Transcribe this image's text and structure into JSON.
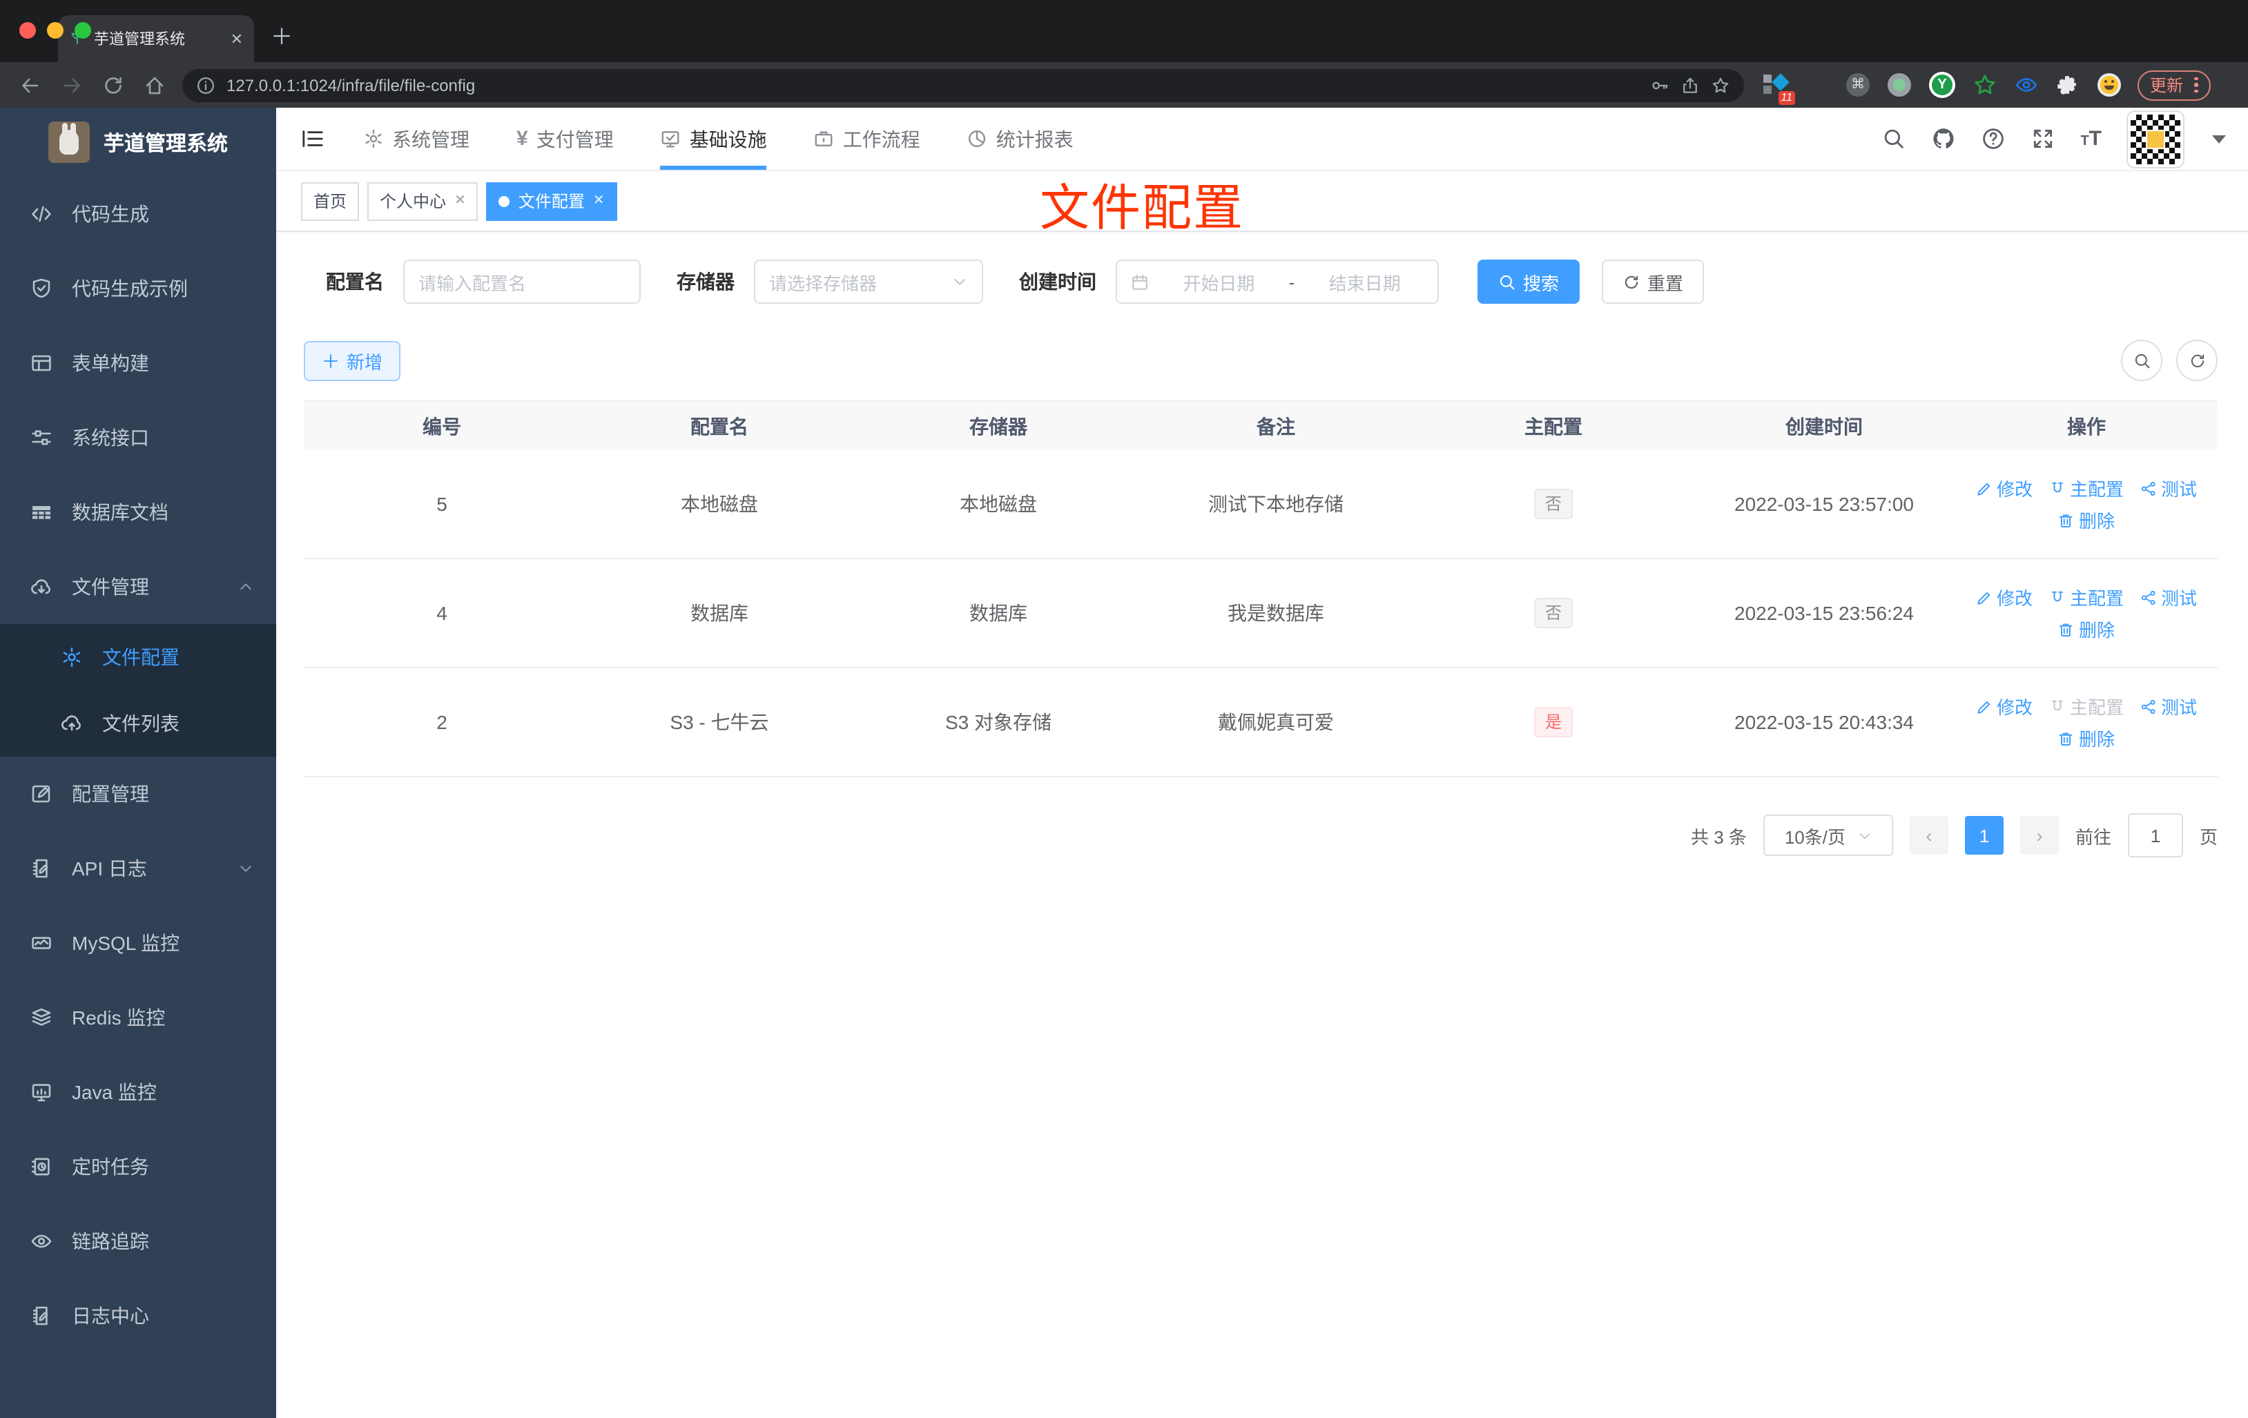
{
  "browser": {
    "tab_title": "芋道管理系统",
    "url": "127.0.0.1:1024/infra/file/file-config",
    "extensions_badge": "11",
    "update_label": "更新"
  },
  "sidebar": {
    "title": "芋道管理系统",
    "items": [
      {
        "label": "代码生成",
        "icon": "code-icon"
      },
      {
        "label": "代码生成示例",
        "icon": "shield-check-icon"
      },
      {
        "label": "表单构建",
        "icon": "form-icon"
      },
      {
        "label": "系统接口",
        "icon": "sliders-icon"
      },
      {
        "label": "数据库文档",
        "icon": "table-grid-icon"
      },
      {
        "label": "文件管理",
        "icon": "cloud-download-icon",
        "expanded": true,
        "children": [
          {
            "label": "文件配置",
            "icon": "gear-icon",
            "active": true
          },
          {
            "label": "文件列表",
            "icon": "cloud-upload-icon"
          }
        ]
      },
      {
        "label": "配置管理",
        "icon": "edit-square-icon"
      },
      {
        "label": "API 日志",
        "icon": "log-pen-icon",
        "collapsed": true
      },
      {
        "label": "MySQL 监控",
        "icon": "chart-card-icon"
      },
      {
        "label": "Redis 监控",
        "icon": "layers-icon"
      },
      {
        "label": "Java 监控",
        "icon": "monitor-icon"
      },
      {
        "label": "定时任务",
        "icon": "schedule-icon"
      },
      {
        "label": "链路追踪",
        "icon": "eye-icon"
      },
      {
        "label": "日志中心",
        "icon": "log-pen-icon"
      }
    ]
  },
  "topnav": {
    "items": [
      {
        "label": "系统管理",
        "icon": "gear-icon"
      },
      {
        "label": "支付管理",
        "icon": "yen-icon"
      },
      {
        "label": "基础设施",
        "icon": "infra-icon",
        "active": true
      },
      {
        "label": "工作流程",
        "icon": "briefcase-icon"
      },
      {
        "label": "统计报表",
        "icon": "dashboard-icon"
      }
    ]
  },
  "tabs": {
    "items": [
      {
        "label": "首页",
        "closable": false,
        "active": false
      },
      {
        "label": "个人中心",
        "closable": true,
        "active": false
      },
      {
        "label": "文件配置",
        "closable": true,
        "active": true
      }
    ]
  },
  "annotation": {
    "text": "文件配置"
  },
  "filters": {
    "name_label": "配置名",
    "name_placeholder": "请输入配置名",
    "storage_label": "存储器",
    "storage_placeholder": "请选择存储器",
    "date_label": "创建时间",
    "date_start": "开始日期",
    "date_sep": "-",
    "date_end": "结束日期",
    "search_label": "搜索",
    "reset_label": "重置"
  },
  "toolbar": {
    "add_label": "新增"
  },
  "table": {
    "columns": [
      "编号",
      "配置名",
      "存储器",
      "备注",
      "主配置",
      "创建时间",
      "操作"
    ],
    "actions": {
      "edit": "修改",
      "primary": "主配置",
      "test": "测试",
      "remove": "删除"
    },
    "rows": [
      {
        "id": "5",
        "name": "本地磁盘",
        "storage": "本地磁盘",
        "remark": "测试下本地存储",
        "primary": "否",
        "primary_type": "info",
        "time": "2022-03-15 23:57:00",
        "primary_config_disabled": false
      },
      {
        "id": "4",
        "name": "数据库",
        "storage": "数据库",
        "remark": "我是数据库",
        "primary": "否",
        "primary_type": "info",
        "time": "2022-03-15 23:56:24",
        "primary_config_disabled": false
      },
      {
        "id": "2",
        "name": "S3 - 七牛云",
        "storage": "S3 对象存储",
        "remark": "戴佩妮真可爱",
        "primary": "是",
        "primary_type": "danger",
        "time": "2022-03-15 20:43:34",
        "primary_config_disabled": true
      }
    ]
  },
  "pagination": {
    "total": "共 3 条",
    "page_size": "10条/页",
    "prev": "‹",
    "next": "›",
    "current_page": "1",
    "goto_label": "前往",
    "goto_value": "1",
    "unit": "页"
  },
  "colors": {
    "accent": "#409eff",
    "sidebar_bg": "#304156",
    "submenu_bg": "#1f2d3d",
    "annotation_red": "#fe3400",
    "danger": "#f56c6c",
    "chrome_bg": "#1c1d1f",
    "toolbar_bg": "#35363a"
  }
}
